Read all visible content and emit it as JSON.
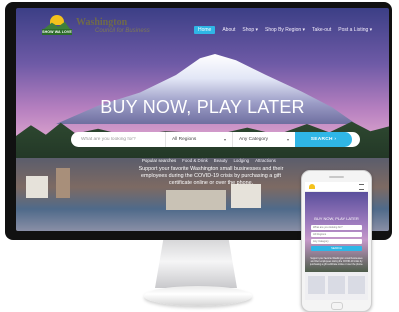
{
  "site": {
    "logo_tag": "SHOW WA LOVE",
    "brand_title": "Washington",
    "brand_subtitle": "Council for Business"
  },
  "nav": {
    "items": [
      {
        "label": "Home",
        "active": true
      },
      {
        "label": "About",
        "active": false
      },
      {
        "label": "Shop ▾",
        "active": false
      },
      {
        "label": "Shop By Region ▾",
        "active": false
      },
      {
        "label": "Take-out",
        "active": false
      },
      {
        "label": "Post a Listing ▾",
        "active": false
      }
    ]
  },
  "hero": {
    "title": "BUY NOW, PLAY LATER",
    "search": {
      "placeholder": "What are you looking for?",
      "region": "All Regions",
      "category": "Any Category",
      "button": "SEARCH ›"
    },
    "popular": {
      "label": "Popular searches",
      "items": [
        "Food & Drink",
        "Beauty",
        "Lodging",
        "Attractions"
      ]
    },
    "text": "Support your favorite Washington small businesses and their employees during the COVID-19 crisis by purchasing a gift certificate online or over the phone."
  },
  "mobile": {
    "title": "BUY NOW, PLAY LATER",
    "field1": "What are you looking for?",
    "field2": "All Regions",
    "field3": "Any Category",
    "button": "SEARCH",
    "text": "Support your favorite Washington small businesses and their employees during the COVID-19 crisis by purchasing a gift certificate online or over the phone."
  },
  "colors": {
    "accent": "#2fb6e6",
    "logo_green": "#2d6d2a",
    "logo_sun": "#f4c21d"
  }
}
